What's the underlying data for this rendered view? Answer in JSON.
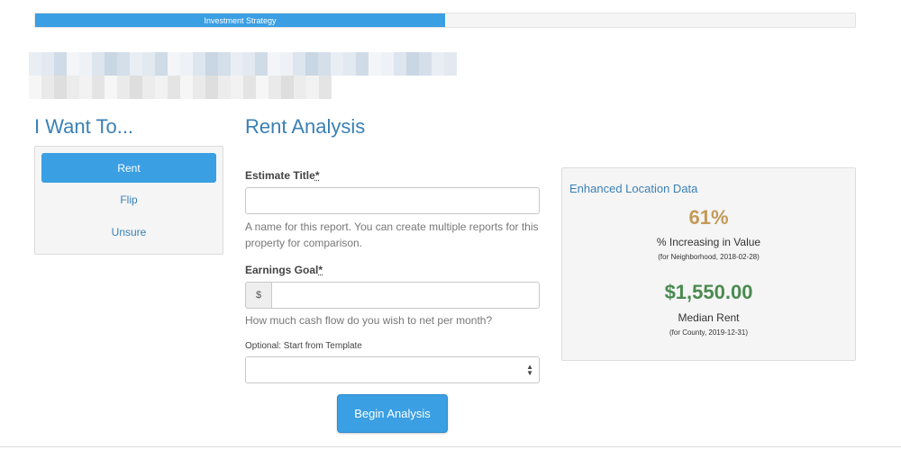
{
  "progress": {
    "label": "Investment Strategy",
    "percent": 50,
    "color": "#3a9fe3"
  },
  "sidebar": {
    "heading": "I Want To...",
    "items": [
      {
        "label": "Rent",
        "active": true
      },
      {
        "label": "Flip",
        "active": false
      },
      {
        "label": "Unsure",
        "active": false
      }
    ]
  },
  "form": {
    "heading": "Rent Analysis",
    "estimate_title": {
      "label": "Estimate Title",
      "required_mark": "*",
      "value": "",
      "help": "A name for this report. You can create multiple reports for this property for comparison."
    },
    "earnings_goal": {
      "label": "Earnings Goal",
      "required_mark": "*",
      "addon": "$",
      "value": "",
      "help": "How much cash flow do you wish to net per month?"
    },
    "template": {
      "label": "Optional: Start from Template",
      "selected": ""
    },
    "submit_label": "Begin Analysis"
  },
  "location": {
    "title": "Enhanced Location Data",
    "stats": [
      {
        "value": "61%",
        "label": "% Increasing in Value",
        "sub": "(for Neighborhood, 2018-02-28)",
        "color": "#c49a57"
      },
      {
        "value": "$1,550.00",
        "label": "Median Rent",
        "sub": "(for County, 2019-12-31)",
        "color": "#4a8a4f"
      }
    ]
  },
  "colors": {
    "accent": "#3a9fe3",
    "heading": "#3a80b5"
  }
}
